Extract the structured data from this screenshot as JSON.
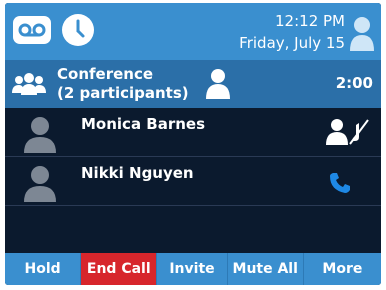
{
  "status_bar": {
    "time": "12:12 PM",
    "date": "Friday, July 15"
  },
  "conference": {
    "title": "Conference",
    "subtitle": "(2 participants)",
    "duration": "2:00"
  },
  "participants": [
    {
      "name": "Monica Barnes",
      "status_icon": "muted-icon"
    },
    {
      "name": "Nikki Nguyen",
      "status_icon": "phone-icon"
    }
  ],
  "softkeys": [
    {
      "label": "Hold"
    },
    {
      "label": "End Call"
    },
    {
      "label": "Invite"
    },
    {
      "label": "Mute All"
    },
    {
      "label": "More"
    }
  ],
  "colors": {
    "status_bar": "#3a8fcf",
    "conference_bar": "#2b6fa8",
    "background": "#0b1a2e",
    "end_call": "#d7262c",
    "phone_icon": "#1e88e5"
  }
}
